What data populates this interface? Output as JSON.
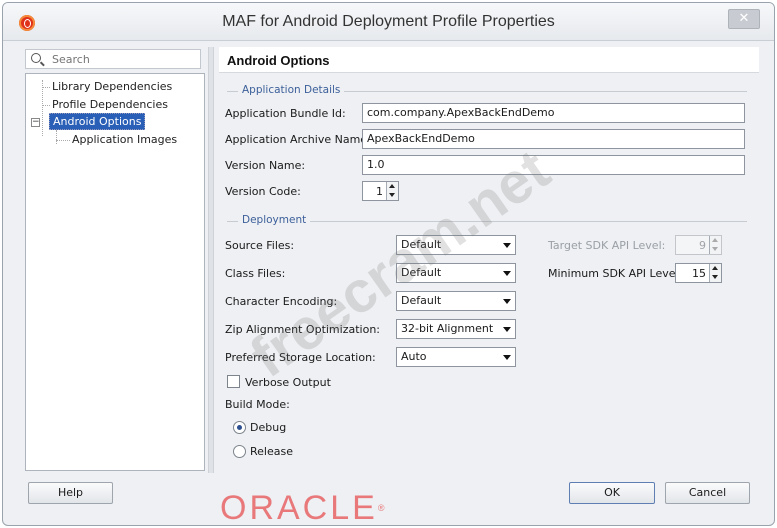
{
  "window": {
    "title": "MAF for Android Deployment Profile Properties",
    "close_glyph": "✕"
  },
  "sidebar": {
    "search_placeholder": "Search",
    "items": [
      {
        "label": "Library Dependencies"
      },
      {
        "label": "Profile Dependencies"
      },
      {
        "label": "Android Options"
      },
      {
        "label": "Application Images"
      }
    ],
    "selected": "Android Options"
  },
  "main": {
    "title": "Android Options",
    "app_details": {
      "header": "Application Details",
      "bundle_id_label": "Application Bundle Id:",
      "bundle_id_value": "com.company.ApexBackEndDemo",
      "archive_name_label": "Application Archive Name:",
      "archive_name_value": "ApexBackEndDemo",
      "version_name_label": "Version Name:",
      "version_name_value": "1.0",
      "version_code_label": "Version Code:",
      "version_code_value": "1"
    },
    "deployment": {
      "header": "Deployment",
      "source_files_label": "Source Files:",
      "source_files_value": "Default",
      "class_files_label": "Class Files:",
      "class_files_value": "Default",
      "char_encoding_label": "Character Encoding:",
      "char_encoding_value": "Default",
      "zip_align_label": "Zip Alignment Optimization:",
      "zip_align_value": "32-bit Alignment",
      "storage_label": "Preferred Storage Location:",
      "storage_value": "Auto",
      "target_sdk_label": "Target SDK API Level:",
      "target_sdk_value": "9",
      "min_sdk_label": "Minimum SDK API Level:",
      "min_sdk_value": "15",
      "verbose_label": "Verbose Output",
      "verbose_checked": false,
      "build_mode_label": "Build Mode:",
      "build_modes": [
        {
          "label": "Debug",
          "selected": true
        },
        {
          "label": "Release",
          "selected": false
        }
      ]
    }
  },
  "footer": {
    "help_label": "Help",
    "ok_label": "OK",
    "cancel_label": "Cancel"
  },
  "branding": {
    "logo_text": "ORACLE",
    "logo_color": "#e8787a",
    "watermark_text": "freecram.net"
  },
  "colors": {
    "selection": "#2a5fb7",
    "section_header": "#3c5f9a"
  },
  "icons": {
    "app": "oracle-o-icon",
    "search": "magnifier-icon",
    "close": "close-icon"
  }
}
